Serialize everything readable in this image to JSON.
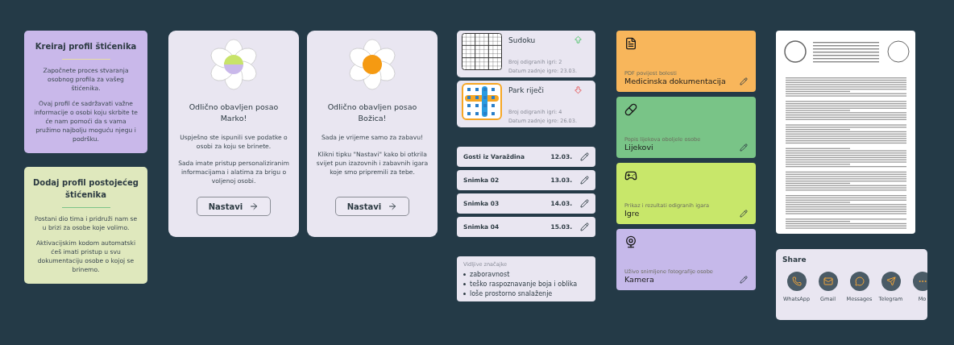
{
  "profile_cards": [
    {
      "title": "Kreiraj profil štićenika",
      "color": "#c9b8ea",
      "paragraphs": [
        "Započnete proces stvaranja osobnog profila za vašeg štićenika.",
        "Ovaj profil će sadržavati važne informacije o osobi koju skrbite te će nam pomoći da s vama pružimo najbolju moguću njegu i podršku."
      ]
    },
    {
      "title": "Dodaj profil postojećeg štićenika",
      "color": "#dfe8bd",
      "paragraphs": [
        "Postani dio tima i pridruži nam se u brizi za osobe koje volimo.",
        "Aktivacijskim kodom automatski ćeš imati pristup u svu dokumentaciju osobe o kojoj se brinemo."
      ]
    }
  ],
  "done_cards": [
    {
      "kind": "split",
      "title": "Odlično obavljen posao Marko!",
      "paragraphs": [
        "Uspješno ste ispunili sve podatke o osobi za koju se brinete.",
        "Sada imate pristup personaliziranim informacijama i alatima za brigu o voljenoj osobi."
      ],
      "button": "Nastavi"
    },
    {
      "kind": "solid",
      "title": "Odlično obavljen posao Božica!",
      "paragraphs": [
        "Sada je vrijeme samo za zabavu!",
        "Klikni tipku \"Nastavi\" kako bi otkrila svijet pun izazovnih i zabavnih igara koje smo pripremili za tebe."
      ],
      "button": "Nastavi"
    }
  ],
  "games": [
    {
      "kind": "sudoku",
      "name": "Sudoku",
      "rising": true,
      "played": "Broj odigranih igri: 2",
      "last": "Datum zadnje igre: 23.03."
    },
    {
      "kind": "words",
      "name": "Park riječi",
      "rising": false,
      "played": "Broj odigranih igri: 4",
      "last": "Datum zadnje igre: 26.03."
    }
  ],
  "recordings": [
    {
      "name": "Gosti iz Varaždina",
      "date": "12.03."
    },
    {
      "name": "Snimka 02",
      "date": "13.03."
    },
    {
      "name": "Snimka 03",
      "date": "14.03."
    },
    {
      "name": "Snimka 04",
      "date": "15.03."
    }
  ],
  "symptoms": {
    "title": "Vidljive značajke",
    "items": [
      "zaboravnost",
      "teško raspoznavanje boja i oblika",
      "loše prostorno snalaženje"
    ]
  },
  "tiles": [
    {
      "kind": "document",
      "color": "#f8b65b",
      "subtitle": "PDF povijest bolesti",
      "title": "Medicinska dokumentacija"
    },
    {
      "kind": "pill",
      "color": "#79c487",
      "subtitle": "Popis lijekova oboljele osobe",
      "title": "Lijekovi"
    },
    {
      "kind": "gamepad",
      "color": "#c8e76a",
      "subtitle": "Prikaz i rezultati odigranih igara",
      "title": "Igre"
    },
    {
      "kind": "webcam",
      "color": "#c6b9ea",
      "subtitle": "Uživo snimljene fotografije osobe",
      "title": "Kamera"
    }
  ],
  "share": {
    "title": "Share",
    "targets": [
      {
        "kind": "whatsapp",
        "label": "WhatsApp"
      },
      {
        "kind": "mail",
        "label": "Gmail"
      },
      {
        "kind": "messages",
        "label": "Messages"
      },
      {
        "kind": "telegram",
        "label": "Telegram"
      },
      {
        "kind": "more",
        "label": "Mo"
      }
    ]
  }
}
